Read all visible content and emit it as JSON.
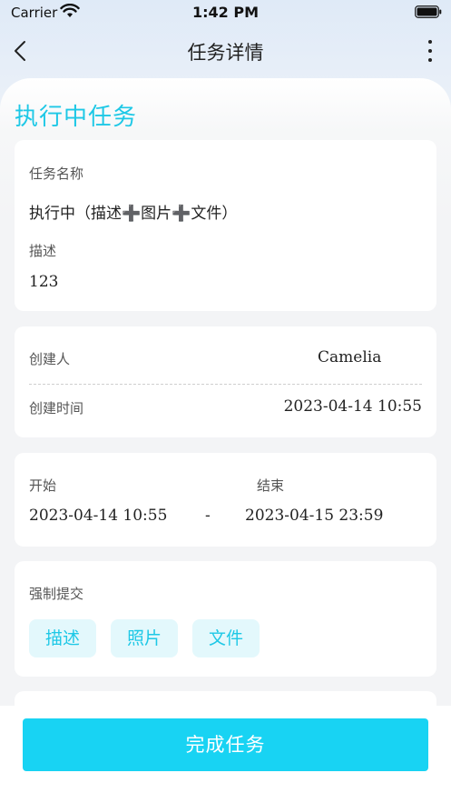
{
  "status_bar": {
    "carrier": "Carrier",
    "time": "1:42 PM"
  },
  "nav": {
    "title": "任务详情"
  },
  "section": {
    "title": "执行中任务"
  },
  "task_card": {
    "name_label": "任务名称",
    "name_value": "执行中（描述➕图片➕文件）",
    "desc_label": "描述",
    "desc_value": "123"
  },
  "creator_card": {
    "creator_label": "创建人",
    "creator_value": "Camelia",
    "created_time_label": "创建时间",
    "created_time_value": "2023-04-14 10:55"
  },
  "time_card": {
    "start_label": "开始",
    "end_label": "结束",
    "start_value": "2023-04-14 10:55",
    "separator": "-",
    "end_value": "2023-04-15 23:59"
  },
  "submit_card": {
    "label": "强制提交",
    "chips": [
      "描述",
      "照片",
      "文件"
    ]
  },
  "footer": {
    "complete_label": "完成任务"
  },
  "colors": {
    "accent": "#1ec8e6",
    "button": "#18d3f3",
    "chip_bg": "#e3f8fc"
  }
}
